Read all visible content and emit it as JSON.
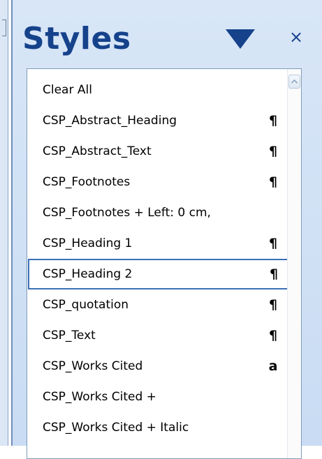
{
  "pane": {
    "title": "Styles",
    "menu_icon": "triangle-down-icon",
    "close_label": "×"
  },
  "style_list": {
    "selected_index": 6,
    "items": [
      {
        "name": "Clear All",
        "mark": ""
      },
      {
        "name": "CSP_Abstract_Heading",
        "mark": "¶"
      },
      {
        "name": "CSP_Abstract_Text",
        "mark": "¶"
      },
      {
        "name": "CSP_Footnotes",
        "mark": "¶"
      },
      {
        "name": "CSP_Footnotes + Left:  0 cm,",
        "mark": ""
      },
      {
        "name": "CSP_Heading 1",
        "mark": "¶"
      },
      {
        "name": "CSP_Heading 2",
        "mark": "¶"
      },
      {
        "name": "CSP_quotation",
        "mark": "¶"
      },
      {
        "name": "CSP_Text",
        "mark": "¶"
      },
      {
        "name": "CSP_Works Cited",
        "mark": "a"
      },
      {
        "name": "CSP_Works Cited +",
        "mark": ""
      },
      {
        "name": "CSP_Works Cited + Italic",
        "mark": ""
      }
    ]
  },
  "icons": {
    "paragraph_style": "pilcrow-icon",
    "character_style": "character-a-icon",
    "scroll_up": "chevron-up-icon"
  },
  "colors": {
    "title": "#15428b",
    "pane_background": "#d8e6f7",
    "selection_border": "#3b6fb6"
  }
}
